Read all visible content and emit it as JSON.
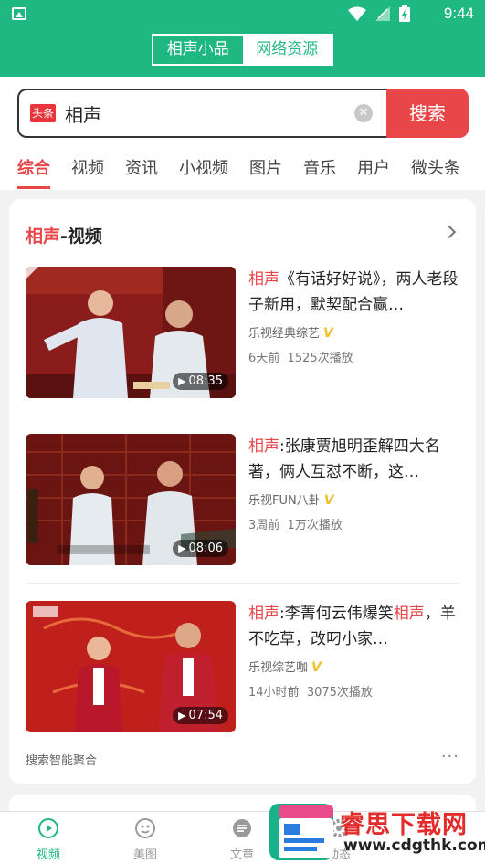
{
  "status_bar": {
    "time": "9:44"
  },
  "header": {
    "segments": [
      "相声小品",
      "网络资源"
    ],
    "active_segment": 0
  },
  "search": {
    "logo_text": "头条",
    "query": "相声",
    "button": "搜索"
  },
  "tabs": [
    "综合",
    "视频",
    "资讯",
    "小视频",
    "图片",
    "音乐",
    "用户",
    "微头条"
  ],
  "section": {
    "highlight": "相声",
    "rest": "-视频"
  },
  "videos": [
    {
      "title_hl": "相声",
      "title_rest": "《有话好好说》，两人老段子新用，默契配合赢…",
      "source": "乐视经典综艺",
      "badge": "V",
      "time": "6天前",
      "plays": "1525次播放",
      "duration": "08:35"
    },
    {
      "title_hl": "相声",
      "title_rest": ":张康贾旭明歪解四大名著，俩人互怼不断，这…",
      "source": "乐视FUN八卦",
      "badge": "V",
      "time": "3周前",
      "plays": "1万次播放",
      "duration": "08:06"
    },
    {
      "title_hl": "相声",
      "title_mid": ":李菁何云伟爆笑",
      "title_hl2": "相声",
      "title_rest": "，羊不吃草，改叼小家…",
      "source": "乐视综艺咖",
      "badge": "V",
      "time": "14小时前",
      "plays": "3075次播放",
      "duration": "07:54"
    }
  ],
  "footer": {
    "aggregate": "搜索智能聚合",
    "more": "···"
  },
  "bottom_nav": [
    "视频",
    "美图",
    "文章",
    "动态"
  ],
  "watermark": {
    "title": "睿思下载网",
    "url": "www.cdgthk.com"
  },
  "colors": {
    "primary_green": "#1fb882",
    "accent_red": "#e9464a"
  }
}
